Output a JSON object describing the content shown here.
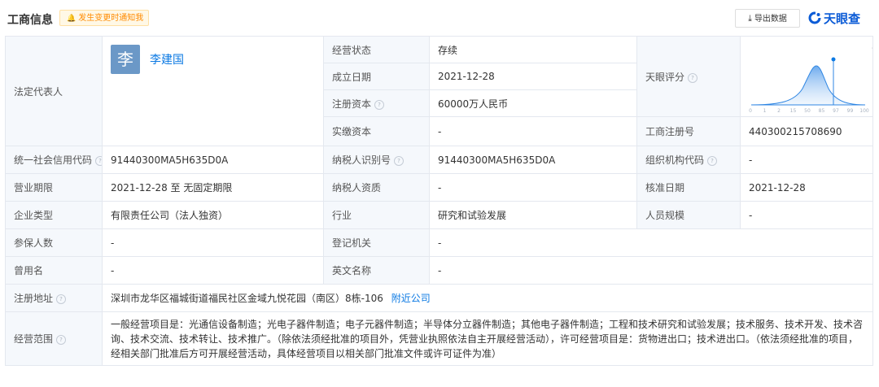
{
  "header": {
    "title": "工商信息",
    "notify_label": "发生变更时通知我",
    "export_label": "导出数据",
    "brand": "天眼查"
  },
  "legal_rep": {
    "label": "法定代表人",
    "avatar_char": "李",
    "name": "李建国"
  },
  "business_status": {
    "label": "经营状态",
    "value": "存续"
  },
  "established": {
    "label": "成立日期",
    "value": "2021-12-28"
  },
  "registered_capital": {
    "label": "注册资本",
    "value": "60000万人民币"
  },
  "paid_capital": {
    "label": "实缴资本",
    "value": "-"
  },
  "tianyan_score": {
    "label": "天眼评分",
    "score_label": "评分",
    "score": "96",
    "axis_ticks": [
      "0",
      "1",
      "2",
      "15",
      "50",
      "85",
      "97",
      "99",
      "100"
    ]
  },
  "reg_number": {
    "label": "工商注册号",
    "value": "440300215708690"
  },
  "credit_code": {
    "label": "统一社会信用代码",
    "value": "91440300MA5H635D0A"
  },
  "taxpayer_id": {
    "label": "纳税人识别号",
    "value": "91440300MA5H635D0A"
  },
  "org_code": {
    "label": "组织机构代码",
    "value": "-"
  },
  "business_term": {
    "label": "营业期限",
    "value": "2021-12-28 至 无固定期限"
  },
  "taxpayer_qual": {
    "label": "纳税人资质",
    "value": "-"
  },
  "approval_date": {
    "label": "核准日期",
    "value": "2021-12-28"
  },
  "company_type": {
    "label": "企业类型",
    "value": "有限责任公司（法人独资）"
  },
  "industry": {
    "label": "行业",
    "value": "研究和试验发展"
  },
  "staff_size": {
    "label": "人员规模",
    "value": "-"
  },
  "insured": {
    "label": "参保人数",
    "value": "-"
  },
  "reg_authority": {
    "label": "登记机关",
    "value": "-"
  },
  "former_name": {
    "label": "曾用名",
    "value": "-"
  },
  "english_name": {
    "label": "英文名称",
    "value": "-"
  },
  "address": {
    "label": "注册地址",
    "value": "深圳市龙华区福城街道福民社区金域九悦花园（南区）8栋-106",
    "nearby_link": "附近公司"
  },
  "scope": {
    "label": "经营范围",
    "value": "一般经营项目是：光通信设备制造；光电子器件制造；电子元器件制造；半导体分立器件制造；其他电子器件制造；工程和技术研究和试验发展；技术服务、技术开发、技术咨询、技术交流、技术转让、技术推广。（除依法须经批准的项目外，凭营业执照依法自主开展经营活动），许可经营项目是：货物进出口；技术进出口。（依法须经批准的项目，经相关部门批准后方可开展经营活动，具体经营项目以相关部门批准文件或许可证件为准）"
  },
  "colors": {
    "accent": "#0b79e3",
    "label_bg": "#f5f8fc",
    "border": "#e4e8ef",
    "notify": "#ff8a00"
  },
  "icons": [
    "bell-icon",
    "help-icon",
    "download-icon",
    "tianyancha-logo-icon"
  ]
}
